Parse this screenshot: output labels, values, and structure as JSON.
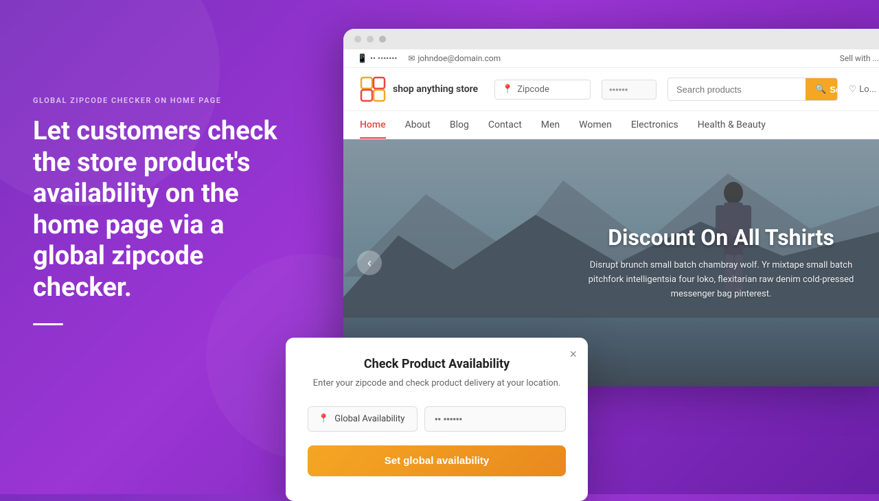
{
  "background": {
    "gradient_start": "#7b2fbe",
    "gradient_end": "#6a1fa8"
  },
  "left_panel": {
    "label": "GLOBAL ZIPCODE CHECKER ON HOME PAGE",
    "headline": "Let customers check the store product's availability on the home page via a global zipcode checker."
  },
  "browser": {
    "topbar": {
      "phone": "•• •••••••",
      "email": "johndoe@domain.com",
      "sell": "Sell with ..."
    },
    "header": {
      "logo_text": "shop anything store",
      "zipcode_label": "Zipcode",
      "zipcode_placeholder": "••••••",
      "search_placeholder": "Search products",
      "search_button": "Search",
      "wishlist_label": "Lo..."
    },
    "nav": {
      "items": [
        {
          "label": "Home",
          "active": true
        },
        {
          "label": "About",
          "active": false
        },
        {
          "label": "Blog",
          "active": false
        },
        {
          "label": "Contact",
          "active": false
        },
        {
          "label": "Men",
          "active": false
        },
        {
          "label": "Women",
          "active": false
        },
        {
          "label": "Electronics",
          "active": false
        },
        {
          "label": "Health & Beauty",
          "active": false
        }
      ]
    },
    "hero": {
      "title": "Discount On All Tshirts",
      "description": "Disrupt brunch small batch chambray wolf. Yr mixtape small batch pitchfork intelligentsia four loko, flexitarian raw denim cold-pressed messenger bag pinterest.",
      "nav_prev": "‹"
    }
  },
  "modal": {
    "title": "Check Product Availability",
    "subtitle": "Enter your zipcode and check product delivery at your location.",
    "close_label": "×",
    "availability_label": "Global Availability",
    "zipcode_placeholder": "•• ••••••",
    "submit_label": "Set global availability"
  }
}
